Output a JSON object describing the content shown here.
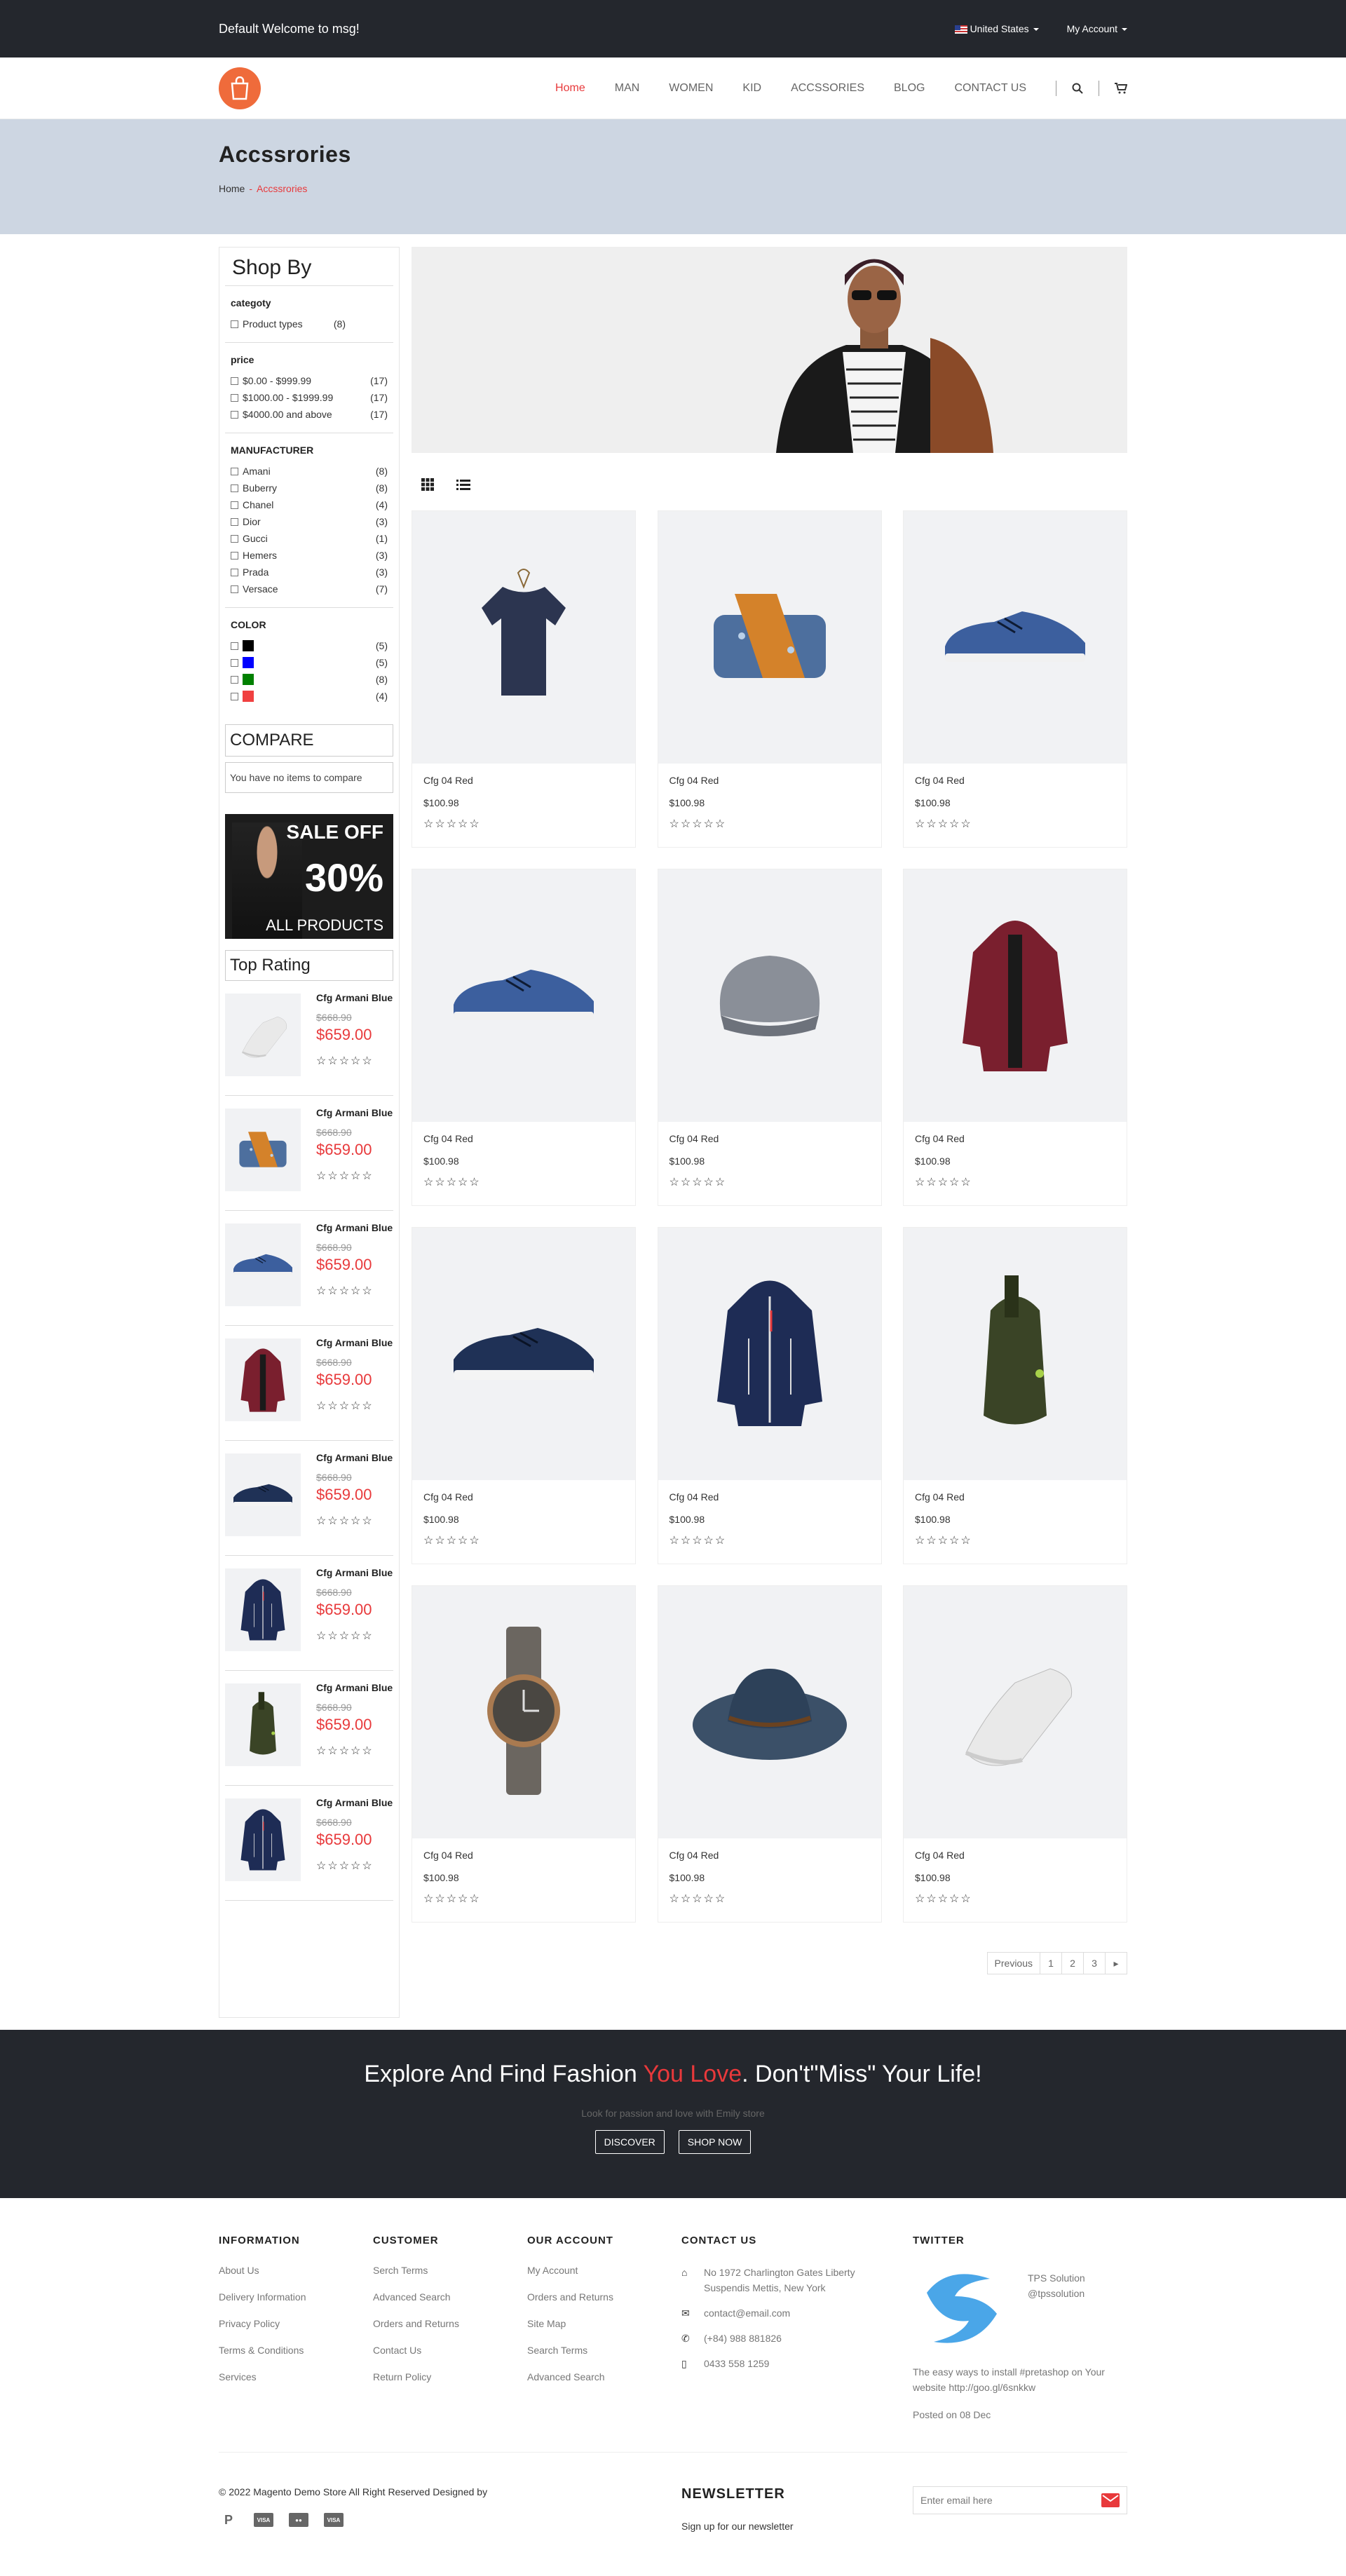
{
  "topbar": {
    "welcome": "Default Welcome to msg!",
    "country": "United States",
    "account": "My Account"
  },
  "nav": {
    "items": [
      "Home",
      "MAN",
      "WOMEN",
      "KID",
      "ACCSSORIES",
      "BLOG",
      "CONTACT US"
    ],
    "active_color": "#e8393b"
  },
  "page": {
    "title": "Accssrories",
    "crumb_home": "Home",
    "crumb_current": "Accssrories"
  },
  "sidebar": {
    "title": "Shop By",
    "category": {
      "heading": "categoty",
      "items": [
        {
          "label": "Product types",
          "count": "(8)"
        }
      ]
    },
    "price": {
      "heading": "price",
      "items": [
        {
          "label": "$0.00 - $999.99",
          "count": "(17)"
        },
        {
          "label": "$1000.00 - $1999.99",
          "count": "(17)"
        },
        {
          "label": "$4000.00 and above",
          "count": "(17)"
        }
      ]
    },
    "manufacturer": {
      "heading": "MANUFACTURER",
      "items": [
        {
          "label": "Amani",
          "count": "(8)"
        },
        {
          "label": "Buberry",
          "count": "(8)"
        },
        {
          "label": "Chanel",
          "count": "(4)"
        },
        {
          "label": "Dior",
          "count": "(3)"
        },
        {
          "label": "Gucci",
          "count": "(1)"
        },
        {
          "label": "Hemers",
          "count": "(3)"
        },
        {
          "label": "Prada",
          "count": "(3)"
        },
        {
          "label": "Versace",
          "count": "(7)"
        }
      ]
    },
    "color": {
      "heading": "COLOR",
      "items": [
        {
          "color": "#000000",
          "count": "(5)"
        },
        {
          "color": "#0000ff",
          "count": "(5)"
        },
        {
          "color": "#008000",
          "count": "(8)"
        },
        {
          "color": "#f04040",
          "count": "(4)"
        }
      ]
    },
    "compare_title": "COMPARE",
    "compare_msg": "You have no items to compare",
    "sale": {
      "line1": "SALE OFF",
      "line2": "30%",
      "line3": "ALL PRODUCTS"
    },
    "top_rating_title": "Top Rating",
    "top_rating": [
      {
        "name": "Cfg Armani Blue",
        "old": "$668.90",
        "new": "$659.00",
        "icon": "sneaker-white-icon"
      },
      {
        "name": "Cfg Armani Blue",
        "old": "$668.90",
        "new": "$659.00",
        "icon": "bag-icon"
      },
      {
        "name": "Cfg Armani Blue",
        "old": "$668.90",
        "new": "$659.00",
        "icon": "shoe-blue-icon"
      },
      {
        "name": "Cfg Armani Blue",
        "old": "$668.90",
        "new": "$659.00",
        "icon": "coat-icon"
      },
      {
        "name": "Cfg Armani Blue",
        "old": "$668.90",
        "new": "$659.00",
        "icon": "shoe-navy-icon"
      },
      {
        "name": "Cfg Armani Blue",
        "old": "$668.90",
        "new": "$659.00",
        "icon": "jacket-icon"
      },
      {
        "name": "Cfg Armani Blue",
        "old": "$668.90",
        "new": "$659.00",
        "icon": "backpack-icon"
      },
      {
        "name": "Cfg Armani Blue",
        "old": "$668.90",
        "new": "$659.00",
        "icon": "jacket-icon"
      }
    ]
  },
  "products": [
    {
      "name": "Cfg 04 Red",
      "price": "$100.98",
      "icon": "tshirt-icon"
    },
    {
      "name": "Cfg 04 Red",
      "price": "$100.98",
      "icon": "bag-icon"
    },
    {
      "name": "Cfg 04 Red",
      "price": "$100.98",
      "icon": "shoe-blue-icon"
    },
    {
      "name": "Cfg 04 Red",
      "price": "$100.98",
      "icon": "shoe-blue-icon"
    },
    {
      "name": "Cfg 04 Red",
      "price": "$100.98",
      "icon": "beanie-icon"
    },
    {
      "name": "Cfg 04 Red",
      "price": "$100.98",
      "icon": "coat-icon"
    },
    {
      "name": "Cfg 04 Red",
      "price": "$100.98",
      "icon": "shoe-navy-icon"
    },
    {
      "name": "Cfg 04 Red",
      "price": "$100.98",
      "icon": "jacket-icon"
    },
    {
      "name": "Cfg 04 Red",
      "price": "$100.98",
      "icon": "backpack-icon"
    },
    {
      "name": "Cfg 04 Red",
      "price": "$100.98",
      "icon": "watch-icon"
    },
    {
      "name": "Cfg 04 Red",
      "price": "$100.98",
      "icon": "hat-icon"
    },
    {
      "name": "Cfg 04 Red",
      "price": "$100.98",
      "icon": "sneaker-white-icon"
    }
  ],
  "rating_stars": "☆☆☆☆☆",
  "pager": {
    "prev": "Previous",
    "pages": [
      "1",
      "2",
      "3"
    ],
    "next": "▸"
  },
  "promo": {
    "title_a": "Explore And Find Fashion ",
    "title_red": "You Love",
    "title_b": ". Don't\"Miss\" Your Life!",
    "sub": "Look for passion and love with Emily store",
    "discover": "DISCOVER",
    "shop": "SHOP NOW"
  },
  "footer": {
    "information": {
      "title": "INFORMATION",
      "links": [
        "About Us",
        "Delivery Information",
        "Privacy Policy",
        "Terms & Conditions",
        "Services"
      ]
    },
    "customer": {
      "title": "CUSTOMER",
      "links": [
        "Serch Terms",
        "Advanced Search",
        "Orders and Returns",
        "Contact Us",
        "Return Policy"
      ]
    },
    "account": {
      "title": "OUR ACCOUNT",
      "links": [
        "My Account",
        "Orders and Returns",
        "Site Map",
        "Search Terms",
        "Advanced Search"
      ]
    },
    "contact": {
      "title": "CONTACT US",
      "address": "No 1972 Charlington Gates Liberty Suspendis Mettis, New York",
      "email": "contact@email.com",
      "phone": "(+84) 988 881826",
      "mobile": "0433 558 1259"
    },
    "twitter": {
      "title": "TWITTER",
      "name": "TPS Solution",
      "handle": "@tpssolution",
      "text": "The easy ways to install #pretashop on Your website http://goo.gl/6snkkw",
      "posted": "Posted on 08 Dec"
    }
  },
  "bottom": {
    "copyright": "© 2022 Magento Demo Store All Right Reserved Designed by",
    "newsletter_title": "NEWSLETTER",
    "newsletter_sub": "Sign up for our newsletter",
    "email_placeholder": "Enter email here"
  }
}
